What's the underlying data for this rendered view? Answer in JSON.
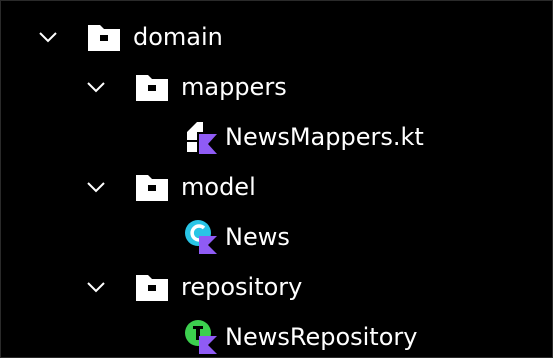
{
  "tree": {
    "root": {
      "label": "domain",
      "expanded": true,
      "icon": "folder-icon",
      "children": [
        {
          "label": "mappers",
          "expanded": true,
          "icon": "folder-icon",
          "files": [
            {
              "label": "NewsMappers.kt",
              "icon": "kotlin-file-icon"
            }
          ]
        },
        {
          "label": "model",
          "expanded": true,
          "icon": "folder-icon",
          "files": [
            {
              "label": "News",
              "icon": "kotlin-class-icon"
            }
          ]
        },
        {
          "label": "repository",
          "expanded": true,
          "icon": "folder-icon",
          "files": [
            {
              "label": "NewsRepository",
              "icon": "kotlin-interface-icon"
            }
          ]
        }
      ]
    }
  },
  "colors": {
    "background": "#000000",
    "text": "#ffffff",
    "kotlin_purple": "#8f5bf5",
    "class_cyan": "#29c5e6",
    "interface_green": "#3ccf4e"
  }
}
